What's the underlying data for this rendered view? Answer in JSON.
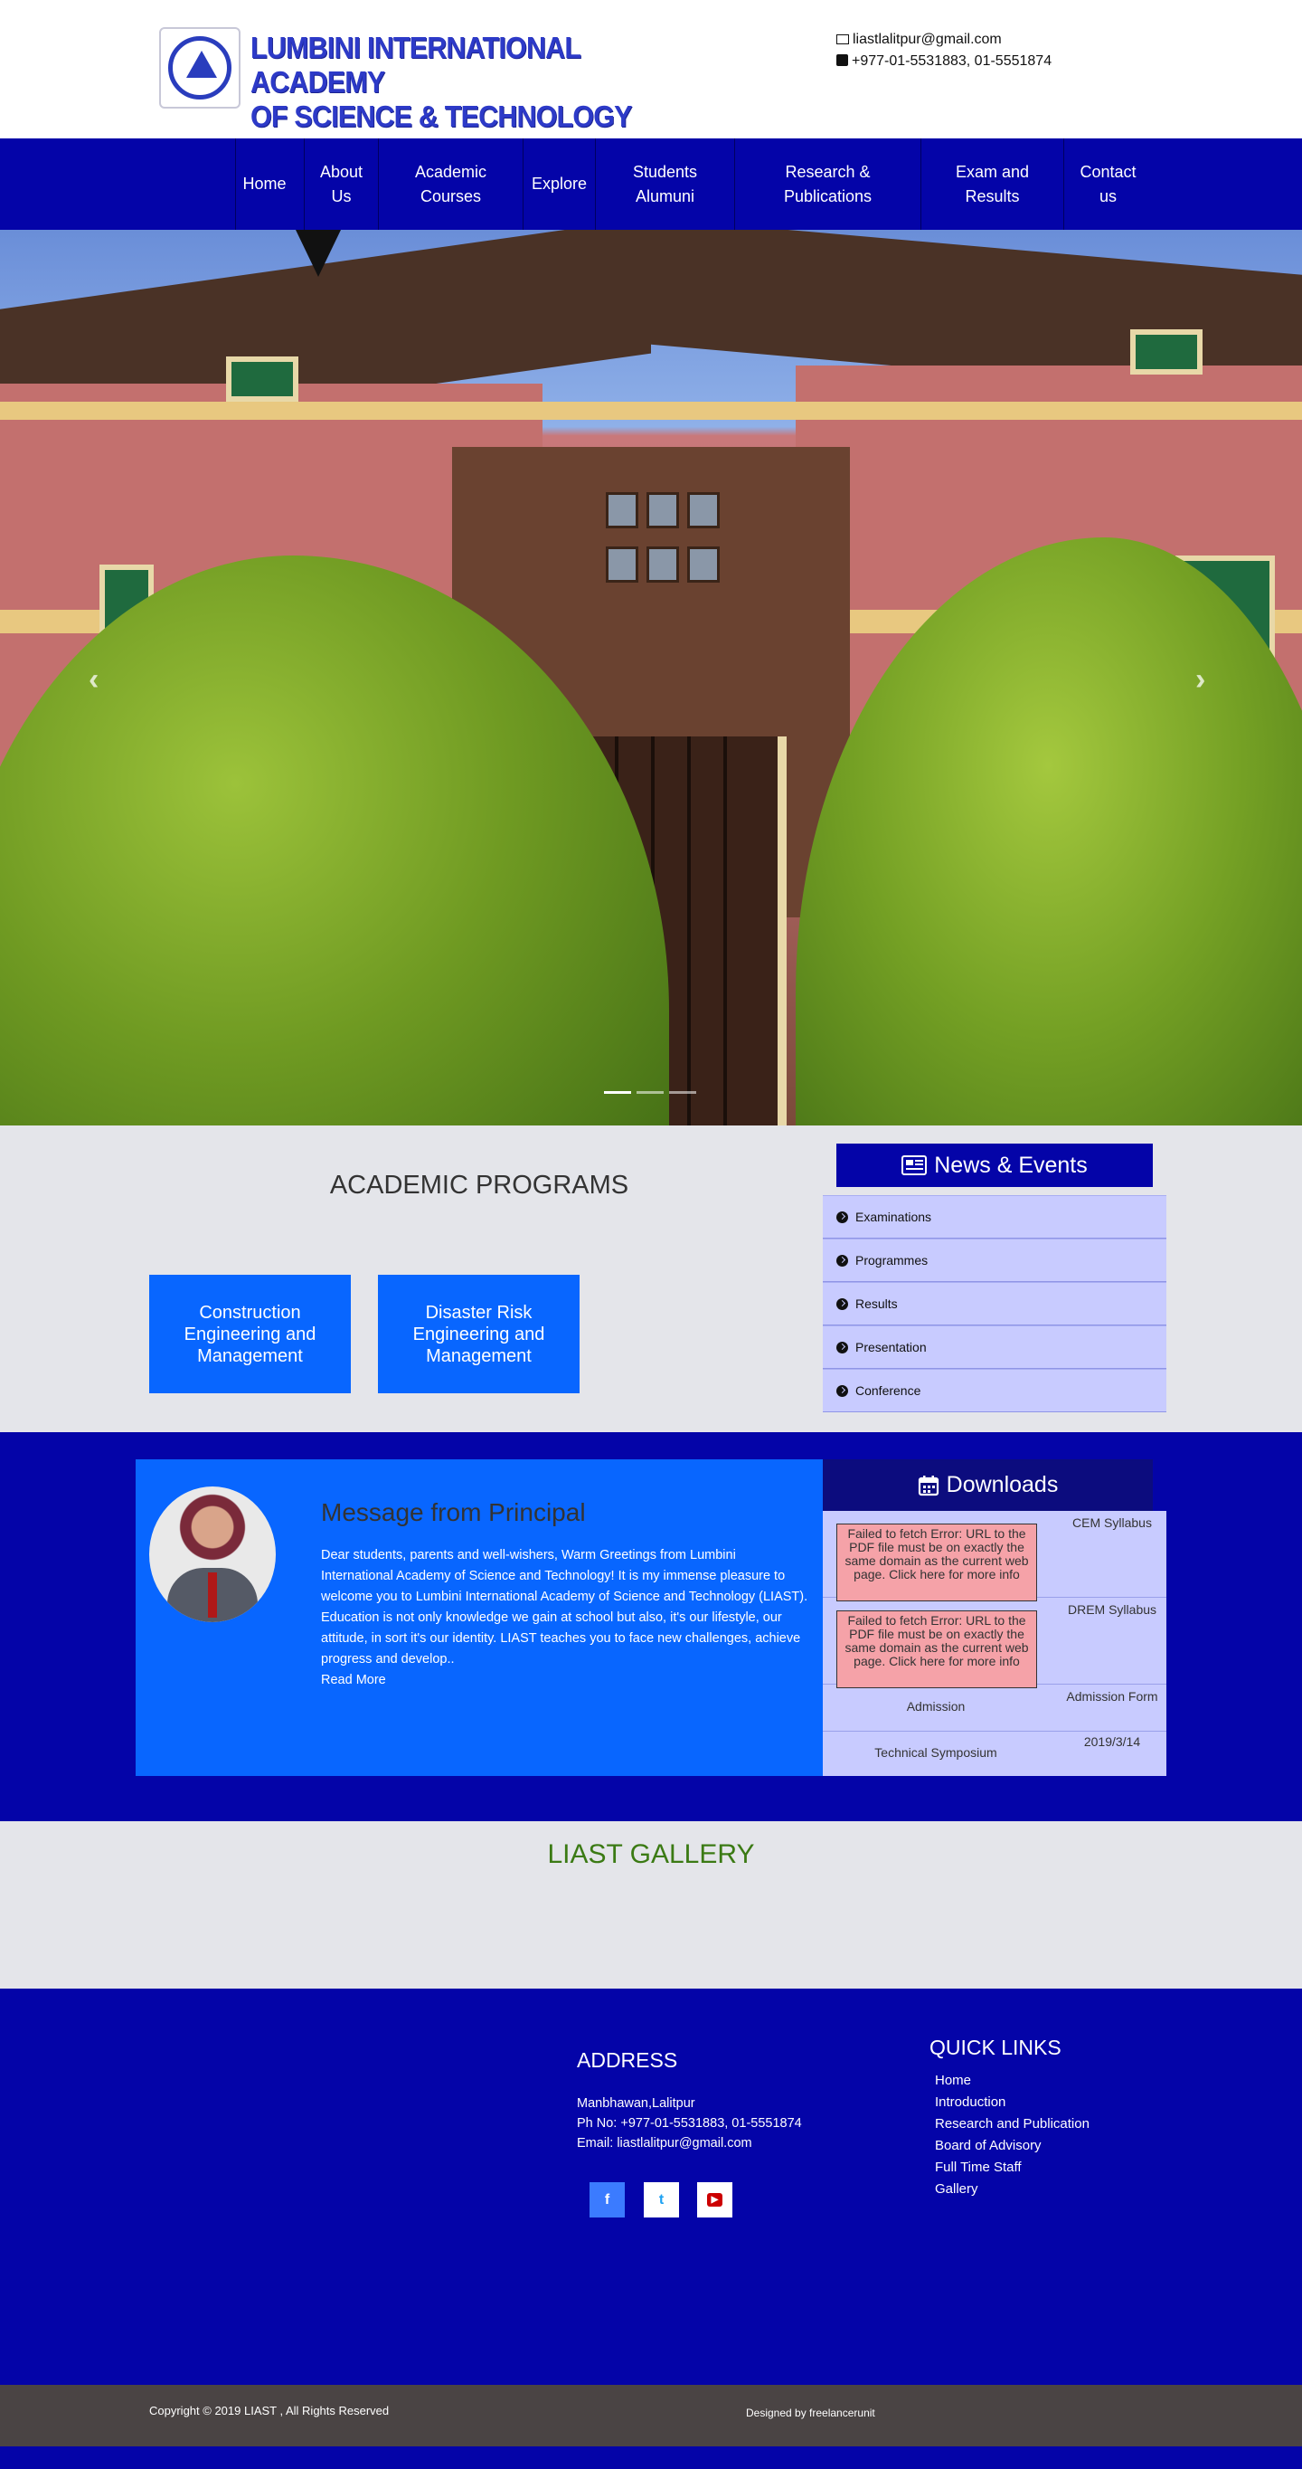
{
  "header": {
    "logo_line1": "LUMBINI INTERNATIONAL ACADEMY",
    "logo_line2": "OF SCIENCE & TECHNOLOGY (LIAST)",
    "email": "liastlalitpur@gmail.com",
    "phone": "+977-01-5531883, 01-5551874",
    "brand_color": "#2d3ac8"
  },
  "nav": {
    "items": [
      {
        "label": "Home"
      },
      {
        "label": "About Us"
      },
      {
        "label": "Academic Courses"
      },
      {
        "label": "Explore"
      },
      {
        "label": "Students Alumuni"
      },
      {
        "label": "Research & Publications"
      },
      {
        "label": "Exam and Results"
      },
      {
        "label": "Contact us"
      }
    ],
    "color": "#0404a8"
  },
  "hero": {
    "prev_icon": "chevron-left-icon",
    "next_icon": "chevron-right-icon",
    "slides": 3,
    "active_slide": 1
  },
  "academic": {
    "title": "ACADEMIC PROGRAMS",
    "programs": [
      {
        "label": "Construction Engineering and Management"
      },
      {
        "label": "Disaster Risk Engineering and Management"
      }
    ]
  },
  "news": {
    "title": "News & Events",
    "items": [
      "Examinations",
      "Programmes",
      "Results",
      "Presentation",
      "Conference"
    ]
  },
  "principal": {
    "title": "Message from Principal",
    "body": "Dear students, parents and well-wishers, Warm Greetings from Lumbini International Academy of Science and Technology! It is my immense pleasure to welcome you to Lumbini International Academy of Science and Technology (LIAST). Education is not only knowledge we gain at school but also, it's our lifestyle, our attitude, in sort it's our identity. LIAST teaches you to face new challenges, achieve progress and develop..",
    "read_more": "Read More"
  },
  "downloads": {
    "title": "Downloads",
    "error_text": "Failed to fetch Error: URL to the PDF file must be on exactly the same domain as the current web page. Click here for more info",
    "rows": [
      {
        "left": "",
        "right": "CEM Syllabus"
      },
      {
        "left": "",
        "right": "DREM Syllabus"
      },
      {
        "left": "Admission",
        "right": "Admission Form"
      },
      {
        "left": "Technical Symposium",
        "right": "2019/3/14"
      }
    ]
  },
  "gallery": {
    "title": "LIAST GALLERY"
  },
  "footer": {
    "address_title": "ADDRESS",
    "address_line": "Manbhawan,Lalitpur",
    "phone_line": "Ph No: +977-01-5531883, 01-5551874",
    "email_line": "Email: liastlalitpur@gmail.com",
    "social": [
      {
        "icon": "facebook-icon",
        "glyph": "f",
        "color": "#ffffff",
        "bg": "#3b7bff"
      },
      {
        "icon": "twitter-icon",
        "glyph": "t",
        "color": "#1da1f2",
        "bg": "#ffffff"
      },
      {
        "icon": "youtube-icon",
        "glyph": "▶",
        "color": "#ffffff",
        "bg": "#cc0000"
      }
    ],
    "quick_links_title": "QUICK LINKS",
    "quick_links": [
      "Home",
      "Introduction",
      "Research and Publication",
      "Board of Advisory",
      "Full Time Staff",
      "Gallery"
    ],
    "copyright": "Copyright © 2019 LIAST , All Rights Reserved",
    "designed_by": "Designed by freelancerunit"
  }
}
